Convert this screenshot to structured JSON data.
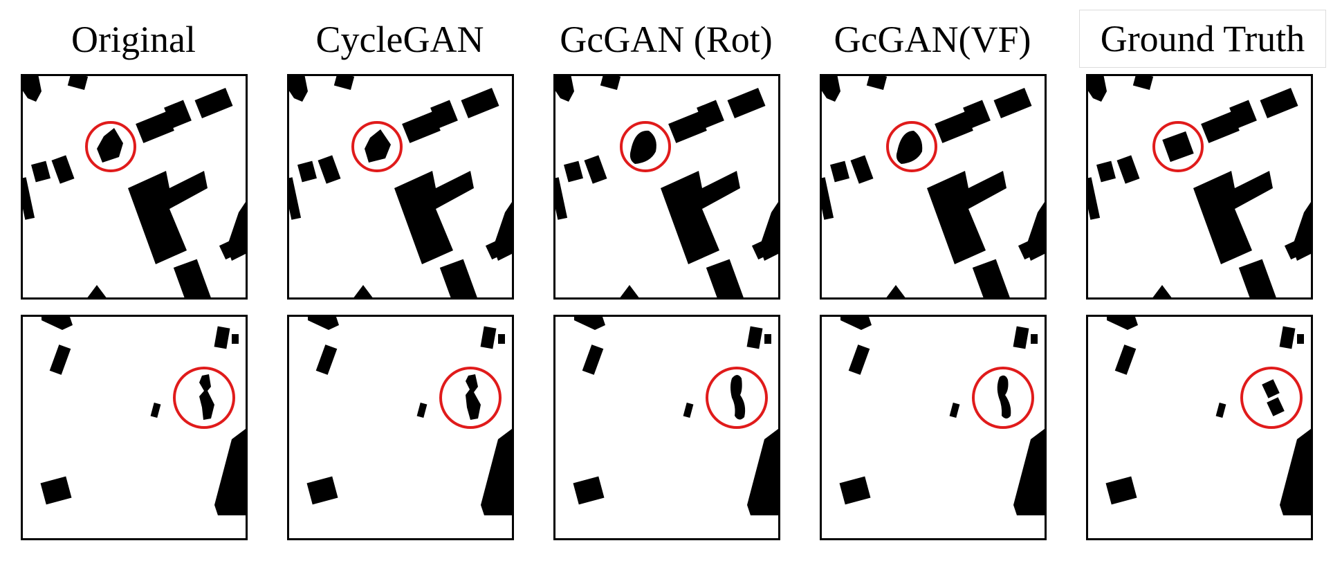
{
  "columns": [
    {
      "title": "Original"
    },
    {
      "title": "CycleGAN"
    },
    {
      "title": "GcGAN (Rot)"
    },
    {
      "title": "GcGAN(VF)"
    },
    {
      "title": "Ground Truth"
    }
  ],
  "colors": {
    "building": "#000000",
    "frame": "#000000",
    "highlight_circle": "#e01b1b",
    "background": "#ffffff"
  }
}
